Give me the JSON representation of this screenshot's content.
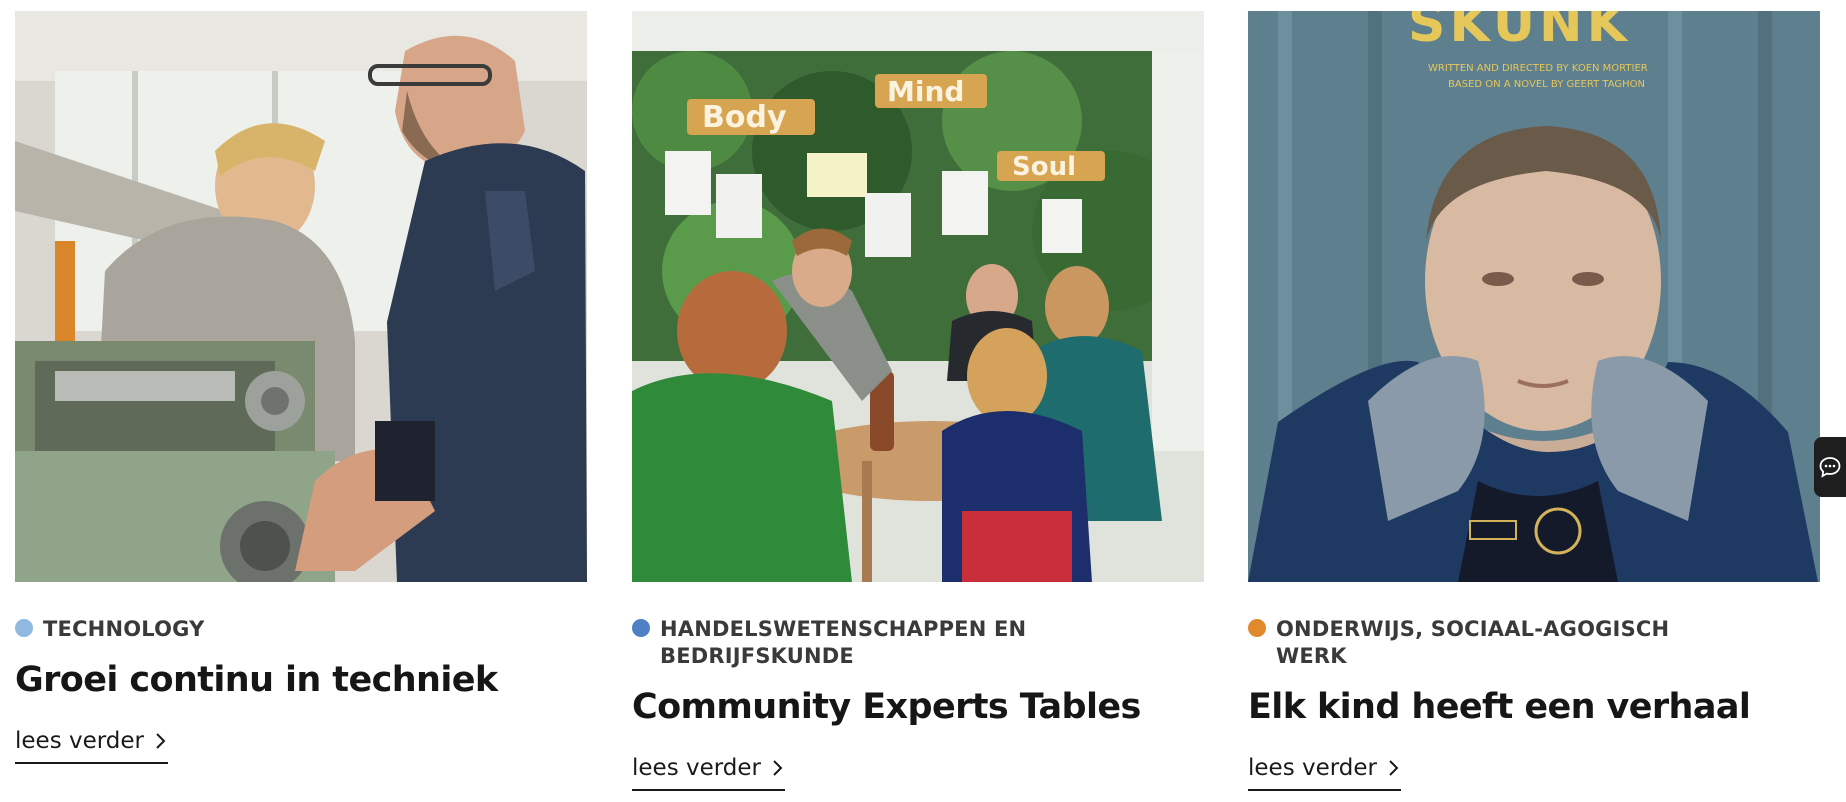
{
  "cards": [
    {
      "image_alt": "Technicus aan een draaibank met een collega",
      "category": {
        "label": "TECHNOLOGY",
        "color": "#8fb9e0"
      },
      "title": "Groei continu in techniek",
      "read_more": "lees verder"
    },
    {
      "image_alt": "Mensen rond een tafel bij Body Mind Soul",
      "category": {
        "label": "HANDELSWETENSCHAPPEN EN BEDRIJFSKUNDE",
        "color": "#4f80c6"
      },
      "title": "Community Experts Tables",
      "read_more": "lees verder"
    },
    {
      "image_alt": "Filmposter Skunk met jonge man",
      "category": {
        "label": "ONDERWIJS, SOCIAAL-AGOGISCH WERK",
        "color": "#e08a2c"
      },
      "title": "Elk kind heeft een verhaal",
      "read_more": "lees verder"
    }
  ],
  "image_texts": {
    "card2_signs": [
      "Body",
      "Mind",
      "Soul"
    ],
    "card3_poster_title": "SKUNK",
    "card3_credits_1": "WRITTEN AND DIRECTED BY KOEN MORTIER",
    "card3_credits_2": "BASED ON A NOVEL BY GEERT TAGHON"
  },
  "icons": {
    "chevron": "chevron-right-icon",
    "chat": "chat-bubble-icon"
  }
}
